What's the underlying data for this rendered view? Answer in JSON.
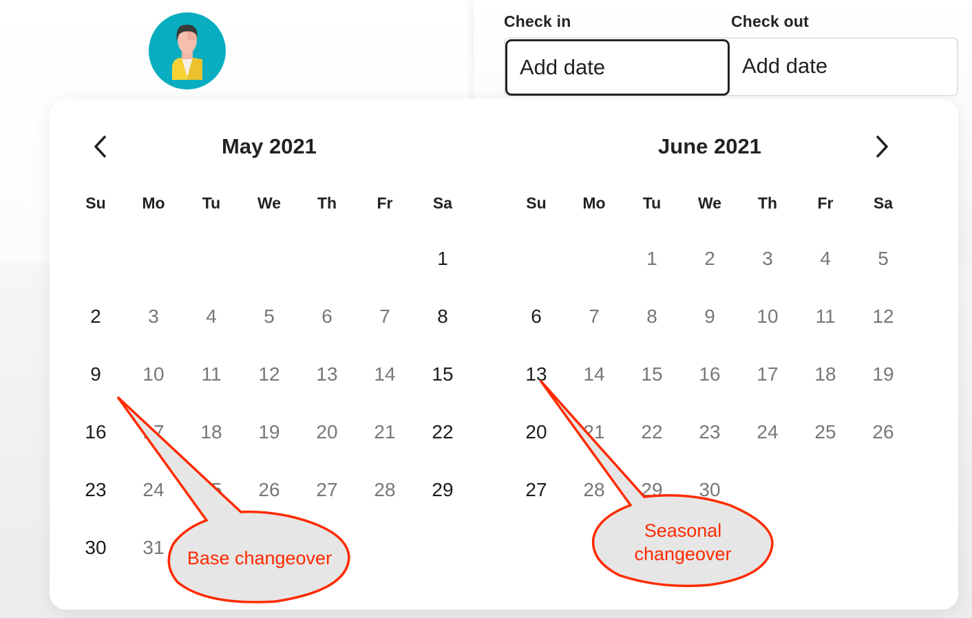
{
  "booking": {
    "check_in_label": "Check in",
    "check_out_label": "Check out",
    "check_in_value": "Add date",
    "check_out_value": "Add date"
  },
  "calendar": {
    "prev_icon": "chevron-left-icon",
    "next_icon": "chevron-right-icon",
    "weekdays": [
      "Su",
      "Mo",
      "Tu",
      "We",
      "Th",
      "Fr",
      "Sa"
    ],
    "months": [
      {
        "title": "May 2021",
        "first_weekday": 6,
        "days": 31,
        "available_days": [
          1,
          2,
          8,
          9,
          15,
          16,
          22,
          23,
          29,
          30
        ]
      },
      {
        "title": "June 2021",
        "first_weekday": 2,
        "days": 30,
        "available_days": [
          6,
          13,
          20,
          27
        ]
      }
    ]
  },
  "annotations": [
    {
      "text": "Base changeover",
      "color": "#ff2a00",
      "points_to": "May 9"
    },
    {
      "text_lines": [
        "Seasonal",
        "changeover"
      ],
      "color": "#ff2a00",
      "points_to": "June 13"
    }
  ],
  "colors": {
    "avatar_bg": "#08aebf",
    "annotation_fill": "#e6e6e6",
    "annotation_stroke": "#ff2a00"
  }
}
